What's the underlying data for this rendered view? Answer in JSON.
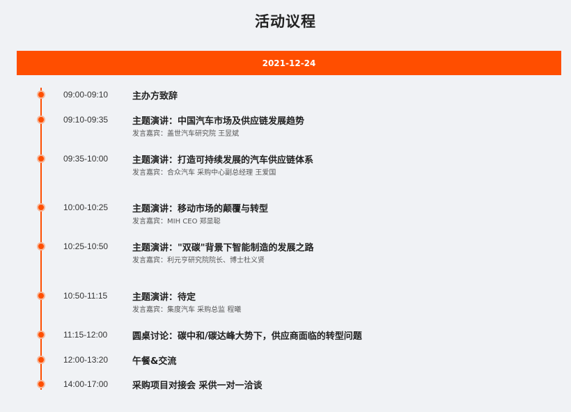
{
  "page": {
    "title": "活动议程"
  },
  "date": "2021-12-24",
  "agenda": [
    {
      "time": "09:00-09:10",
      "title": "主办方致辞",
      "speaker": ""
    },
    {
      "time": "09:10-09:35",
      "title": "主题演讲：中国汽车市场及供应链发展趋势",
      "speaker": "发言嘉宾：盖世汽车研究院 王昱斌"
    },
    {
      "time": "09:35-10:00",
      "title": "主题演讲：打造可持续发展的汽车供应链体系",
      "speaker": "发言嘉宾：合众汽车 采购中心副总经理 王爱国"
    },
    {
      "time": "10:00-10:25",
      "title": "主题演讲：移动市场的颠覆与转型",
      "speaker": "发言嘉宾：MIH CEO 郑显聪"
    },
    {
      "time": "10:25-10:50",
      "title": "主题演讲：\"双碳\"背景下智能制造的发展之路",
      "speaker": "发言嘉宾：利元亨研究院院长、博士杜义贤"
    },
    {
      "time": "10:50-11:15",
      "title": "主题演讲：待定",
      "speaker": "发言嘉宾：集度汽车 采购总监 程曦"
    },
    {
      "time": "11:15-12:00",
      "title": "圆桌讨论：碳中和/碳达峰大势下，供应商面临的转型问题",
      "speaker": ""
    },
    {
      "time": "12:00-13:20",
      "title": "午餐&交流",
      "speaker": ""
    },
    {
      "time": "14:00-17:00",
      "title": "采购项目对接会 采供一对一洽谈",
      "speaker": ""
    }
  ]
}
